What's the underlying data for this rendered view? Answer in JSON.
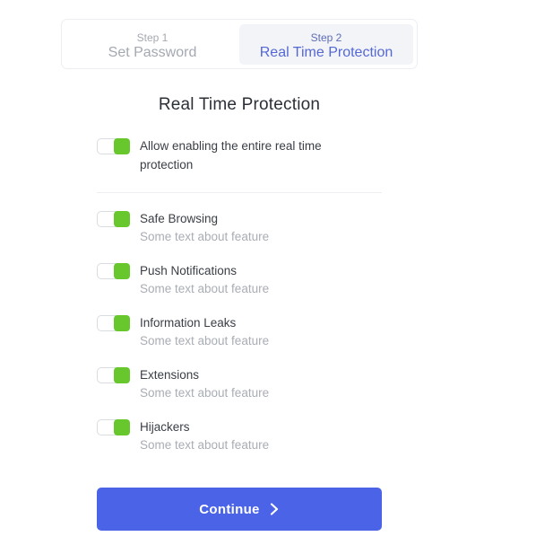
{
  "stepper": {
    "steps": [
      {
        "number": "Step 1",
        "label": "Set Password",
        "active": false
      },
      {
        "number": "Step 2",
        "label": "Real Time Protection",
        "active": true
      }
    ]
  },
  "heading": "Real Time Protection",
  "master": {
    "label": "Allow enabling the entire real time protection",
    "enabled": true
  },
  "features": [
    {
      "title": "Safe Browsing",
      "description": "Some text about feature",
      "enabled": true
    },
    {
      "title": "Push Notifications",
      "description": "Some text about feature",
      "enabled": true
    },
    {
      "title": "Information Leaks",
      "description": "Some text about feature",
      "enabled": true
    },
    {
      "title": "Extensions",
      "description": "Some text about feature",
      "enabled": true
    },
    {
      "title": "Hijackers",
      "description": "Some text about feature",
      "enabled": true
    }
  ],
  "continue_label": "Continue",
  "icons": {
    "continue_icon": "chevron-right-icon"
  },
  "colors": {
    "accent": "#4a63e7",
    "toggle_on": "#67c72d",
    "active_step_text": "#5568d4"
  }
}
